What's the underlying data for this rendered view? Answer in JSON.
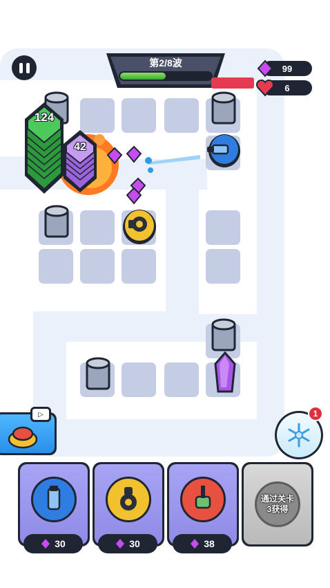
{
  "hud": {
    "wave_label": "第2/8波",
    "wave_progress_fraction": 0.5,
    "gems": "99",
    "lives": "6"
  },
  "enemies": [
    {
      "label": "124",
      "color": "#3bb54a"
    },
    {
      "label": "42",
      "color": "#b27bea"
    }
  ],
  "shop": [
    {
      "name": "blue-cannon",
      "cost": "30",
      "color": "#2f7de0"
    },
    {
      "name": "yellow-mortar",
      "cost": "30",
      "color": "#f2c12e"
    },
    {
      "name": "red-tank",
      "cost": "38",
      "color": "#e8503f"
    }
  ],
  "locked": {
    "line1": "通过关卡",
    "line2": "3获得"
  },
  "freeze": {
    "badge": "1"
  },
  "colors": {
    "gem": "#c64cf0",
    "heart": "#e63a50",
    "health_bar": "#e63a50",
    "wave_fill": "#5bc43e"
  }
}
